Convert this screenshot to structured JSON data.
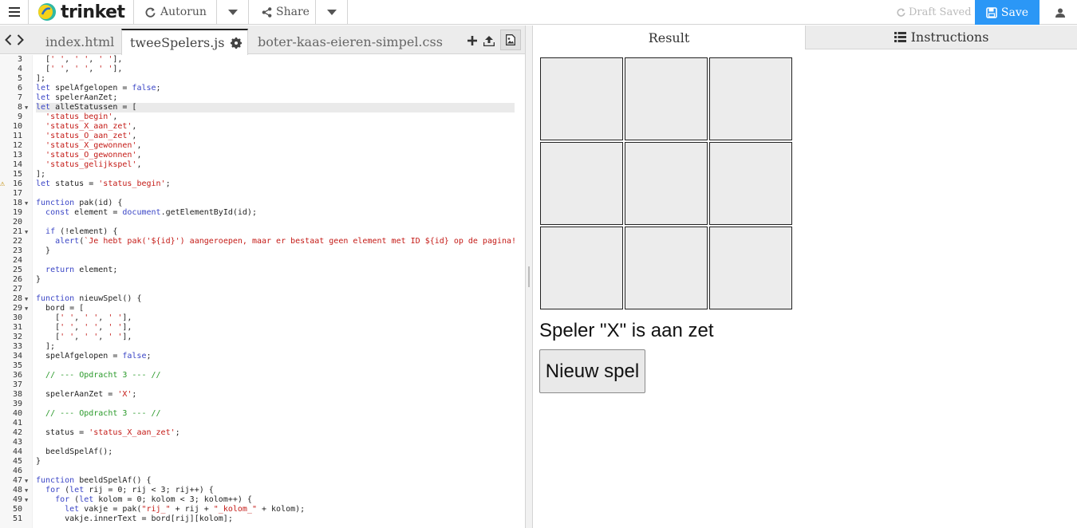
{
  "topbar": {
    "logo_text": "trinket",
    "autorun_label": "Autorun",
    "share_label": "Share",
    "draft_status": "Draft Saved",
    "save_label": "Save"
  },
  "editor": {
    "tabs": [
      {
        "label": "index.html",
        "active": false
      },
      {
        "label": "tweeSpelers.js",
        "active": true
      },
      {
        "label": "boter-kaas-eieren-simpel.css",
        "active": false
      }
    ],
    "lines": [
      {
        "n": "3",
        "fold": false,
        "warn": false,
        "code": "  [' ', ' ', ' '],"
      },
      {
        "n": "4",
        "fold": false,
        "warn": false,
        "code": "  [' ', ' ', ' '],"
      },
      {
        "n": "5",
        "fold": false,
        "warn": false,
        "code": "];"
      },
      {
        "n": "6",
        "fold": false,
        "warn": false,
        "code": "let spelAfgelopen = false;"
      },
      {
        "n": "7",
        "fold": false,
        "warn": false,
        "code": "let spelerAanZet;"
      },
      {
        "n": "8",
        "fold": true,
        "warn": false,
        "code": "let alleStatussen = [",
        "active": true
      },
      {
        "n": "9",
        "fold": false,
        "warn": false,
        "code": "  'status_begin',"
      },
      {
        "n": "10",
        "fold": false,
        "warn": false,
        "code": "  'status_X_aan_zet',"
      },
      {
        "n": "11",
        "fold": false,
        "warn": false,
        "code": "  'status_O_aan_zet',"
      },
      {
        "n": "12",
        "fold": false,
        "warn": false,
        "code": "  'status_X_gewonnen',"
      },
      {
        "n": "13",
        "fold": false,
        "warn": false,
        "code": "  'status_O_gewonnen',"
      },
      {
        "n": "14",
        "fold": false,
        "warn": false,
        "code": "  'status_gelijkspel',"
      },
      {
        "n": "15",
        "fold": false,
        "warn": false,
        "code": "];"
      },
      {
        "n": "16",
        "fold": false,
        "warn": true,
        "code": "let status = 'status_begin';"
      },
      {
        "n": "17",
        "fold": false,
        "warn": false,
        "code": ""
      },
      {
        "n": "18",
        "fold": true,
        "warn": false,
        "code": "function pak(id) {"
      },
      {
        "n": "19",
        "fold": false,
        "warn": false,
        "code": "  const element = document.getElementById(id);"
      },
      {
        "n": "20",
        "fold": false,
        "warn": false,
        "code": ""
      },
      {
        "n": "21",
        "fold": true,
        "warn": false,
        "code": "  if (!element) {"
      },
      {
        "n": "22",
        "fold": false,
        "warn": false,
        "code": "    alert(`Je hebt pak('${id}') aangeroepen, maar er bestaat geen element met ID ${id} op de pagina!"
      },
      {
        "n": "23",
        "fold": false,
        "warn": false,
        "code": "  }"
      },
      {
        "n": "24",
        "fold": false,
        "warn": false,
        "code": ""
      },
      {
        "n": "25",
        "fold": false,
        "warn": false,
        "code": "  return element;"
      },
      {
        "n": "26",
        "fold": false,
        "warn": false,
        "code": "}"
      },
      {
        "n": "27",
        "fold": false,
        "warn": false,
        "code": ""
      },
      {
        "n": "28",
        "fold": true,
        "warn": false,
        "code": "function nieuwSpel() {"
      },
      {
        "n": "29",
        "fold": true,
        "warn": false,
        "code": "  bord = ["
      },
      {
        "n": "30",
        "fold": false,
        "warn": false,
        "code": "    [' ', ' ', ' '],"
      },
      {
        "n": "31",
        "fold": false,
        "warn": false,
        "code": "    [' ', ' ', ' '],"
      },
      {
        "n": "32",
        "fold": false,
        "warn": false,
        "code": "    [' ', ' ', ' '],"
      },
      {
        "n": "33",
        "fold": false,
        "warn": false,
        "code": "  ];"
      },
      {
        "n": "34",
        "fold": false,
        "warn": false,
        "code": "  spelAfgelopen = false;"
      },
      {
        "n": "35",
        "fold": false,
        "warn": false,
        "code": ""
      },
      {
        "n": "36",
        "fold": false,
        "warn": false,
        "code": "  // --- Opdracht 3 --- //"
      },
      {
        "n": "37",
        "fold": false,
        "warn": false,
        "code": ""
      },
      {
        "n": "38",
        "fold": false,
        "warn": false,
        "code": "  spelerAanZet = 'X';"
      },
      {
        "n": "39",
        "fold": false,
        "warn": false,
        "code": ""
      },
      {
        "n": "40",
        "fold": false,
        "warn": false,
        "code": "  // --- Opdracht 3 --- //"
      },
      {
        "n": "41",
        "fold": false,
        "warn": false,
        "code": ""
      },
      {
        "n": "42",
        "fold": false,
        "warn": false,
        "code": "  status = 'status_X_aan_zet';"
      },
      {
        "n": "43",
        "fold": false,
        "warn": false,
        "code": ""
      },
      {
        "n": "44",
        "fold": false,
        "warn": false,
        "code": "  beeldSpelAf();"
      },
      {
        "n": "45",
        "fold": false,
        "warn": false,
        "code": "}"
      },
      {
        "n": "46",
        "fold": false,
        "warn": false,
        "code": ""
      },
      {
        "n": "47",
        "fold": true,
        "warn": false,
        "code": "function beeldSpelAf() {"
      },
      {
        "n": "48",
        "fold": true,
        "warn": false,
        "code": "  for (let rij = 0; rij < 3; rij++) {"
      },
      {
        "n": "49",
        "fold": true,
        "warn": false,
        "code": "    for (let kolom = 0; kolom < 3; kolom++) {"
      },
      {
        "n": "50",
        "fold": false,
        "warn": false,
        "code": "      let vakje = pak(\"rij_\" + rij + \"_kolom_\" + kolom);"
      },
      {
        "n": "51",
        "fold": false,
        "warn": false,
        "code": "      vakje.innerText = bord[rij][kolom];"
      }
    ]
  },
  "result": {
    "tab_result": "Result",
    "tab_instructions": "Instructions",
    "status_text": "Speler \"X\" is aan zet",
    "new_game_label": "Nieuw spel"
  },
  "colors": {
    "accent": "#2b97f6",
    "keyword": "#3a45c6",
    "string": "#c41a16",
    "comment": "#2a9a2a",
    "cell_bg": "#ececec"
  }
}
